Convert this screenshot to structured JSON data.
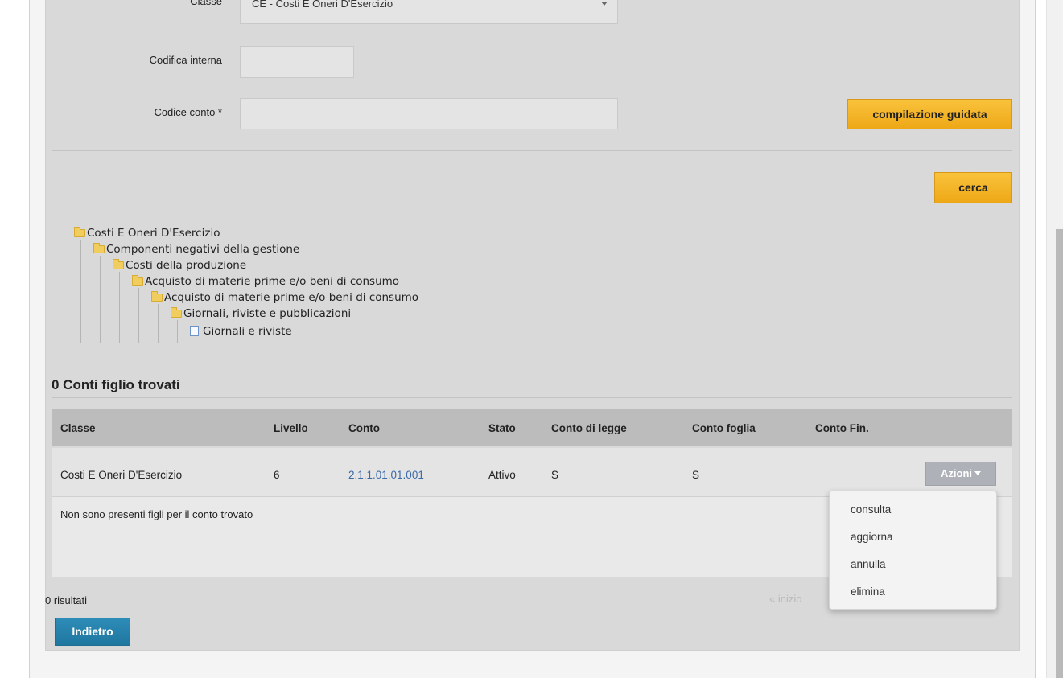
{
  "form": {
    "classe_label": "Classe",
    "classe_value": "CE - Costi E Oneri D'Esercizio",
    "codifica_label": "Codifica interna",
    "codifica_value": "",
    "codice_label": "Codice conto *",
    "codice_value": "",
    "compilazione_button": "compilazione guidata",
    "cerca_button": "cerca"
  },
  "tree": [
    {
      "label": "Costi E Oneri D'Esercizio",
      "icon": "folder-icon"
    },
    {
      "label": "Componenti negativi della gestione",
      "icon": "folder-icon"
    },
    {
      "label": "Costi della produzione",
      "icon": "folder-icon"
    },
    {
      "label": "Acquisto di materie prime e/o beni di consumo",
      "icon": "folder-icon"
    },
    {
      "label": "Acquisto di materie prime e/o beni di consumo",
      "icon": "folder-icon"
    },
    {
      "label": "Giornali, riviste e pubblicazioni",
      "icon": "folder-icon"
    },
    {
      "label": "Giornali e riviste",
      "icon": "file-icon"
    }
  ],
  "results": {
    "title": "0 Conti figlio trovati",
    "columns": [
      "Classe",
      "Livello",
      "Conto",
      "Stato",
      "Conto di legge",
      "Conto foglia",
      "Conto Fin."
    ],
    "row": {
      "classe": "Costi E Oneri D'Esercizio",
      "livello": "6",
      "conto": "2.1.1.01.01.001",
      "stato": "Attivo",
      "conto_di_legge": "S",
      "conto_foglia": "S",
      "conto_fin": ""
    },
    "azioni_button": "Azioni",
    "empty_message": "Non sono presenti figli per il conto trovato",
    "count_text": "0 risultati",
    "pager_start": "« inizio",
    "back_button": "Indietro"
  },
  "menu": [
    "consulta",
    "aggiorna",
    "annulla",
    "elimina"
  ],
  "colors": {
    "accent_yellow": "#f5b52a",
    "accent_blue": "#2784ad",
    "link": "#3b6aa8",
    "panel_bg": "#d9d9d9"
  }
}
